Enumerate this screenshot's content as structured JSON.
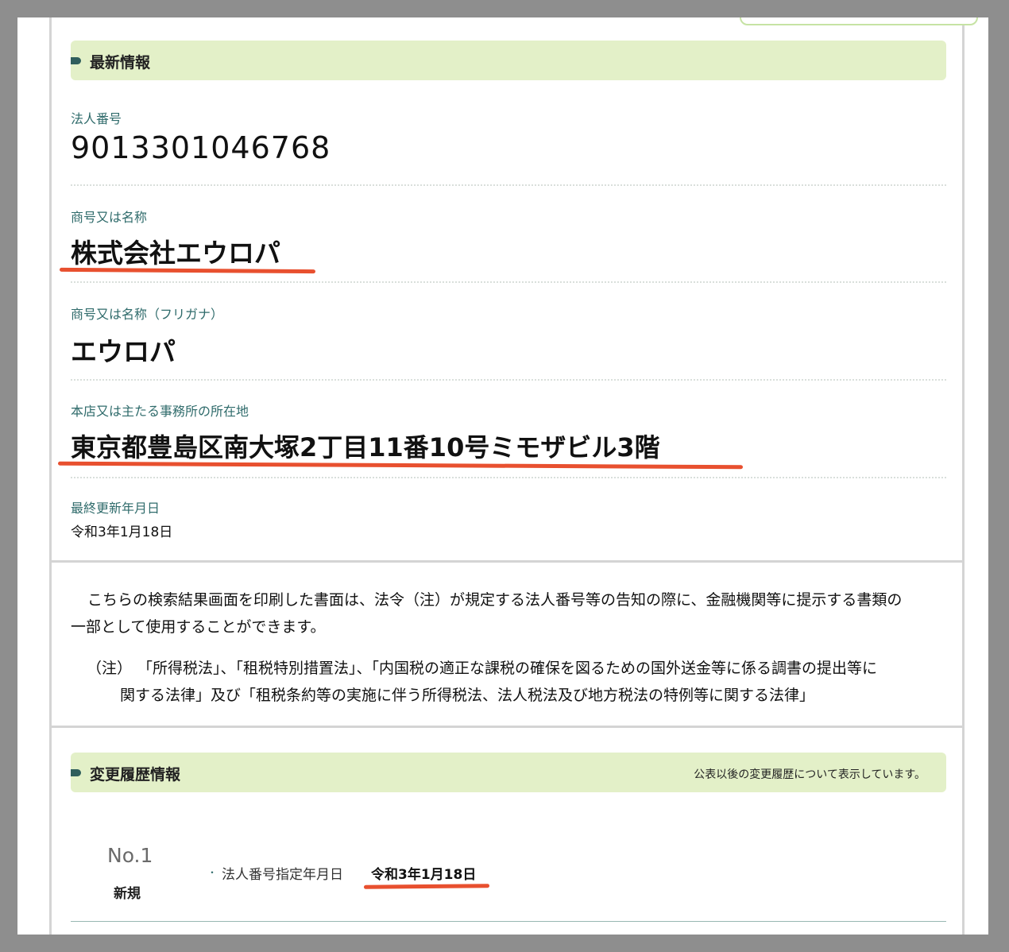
{
  "latest": {
    "header": "最新情報",
    "corporate_number_label": "法人番号",
    "corporate_number": "9013301046768",
    "name_label": "商号又は名称",
    "name": "株式会社エウロパ",
    "furigana_label": "商号又は名称（フリガナ）",
    "furigana": "エウロパ",
    "address_label": "本店又は主たる事務所の所在地",
    "address": "東京都豊島区南大塚2丁目11番10号ミモザビル3階",
    "updated_label": "最終更新年月日",
    "updated": "令和3年1月18日"
  },
  "notice": {
    "paragraph_line1": "こちらの検索結果画面を印刷した書面は、法令（注）が規定する法人番号等の告知の際に、金融機関等に提示する書類の",
    "paragraph_line2": "一部として使用することができます。",
    "note_mark": "（注）",
    "note_line1": "「所得税法」、「租税特別措置法」、「内国税の適正な課税の確保を図るための国外送金等に係る調書の提出等に",
    "note_line2": "関する法律」及び「租税条約等の実施に伴う所得税法、法人税法及び地方税法の特例等に関する法律」"
  },
  "history": {
    "header": "変更履歴情報",
    "note": "公表以後の変更履歴について表示しています。",
    "items": [
      {
        "no": "No.1",
        "type": "新規",
        "bullet": "・",
        "label": "法人番号指定年月日",
        "date": "令和3年1月18日"
      }
    ]
  },
  "colors": {
    "header_bg": "#e3f0c8",
    "label_teal": "#2f6b6b",
    "annotation_red": "#e8502f"
  }
}
